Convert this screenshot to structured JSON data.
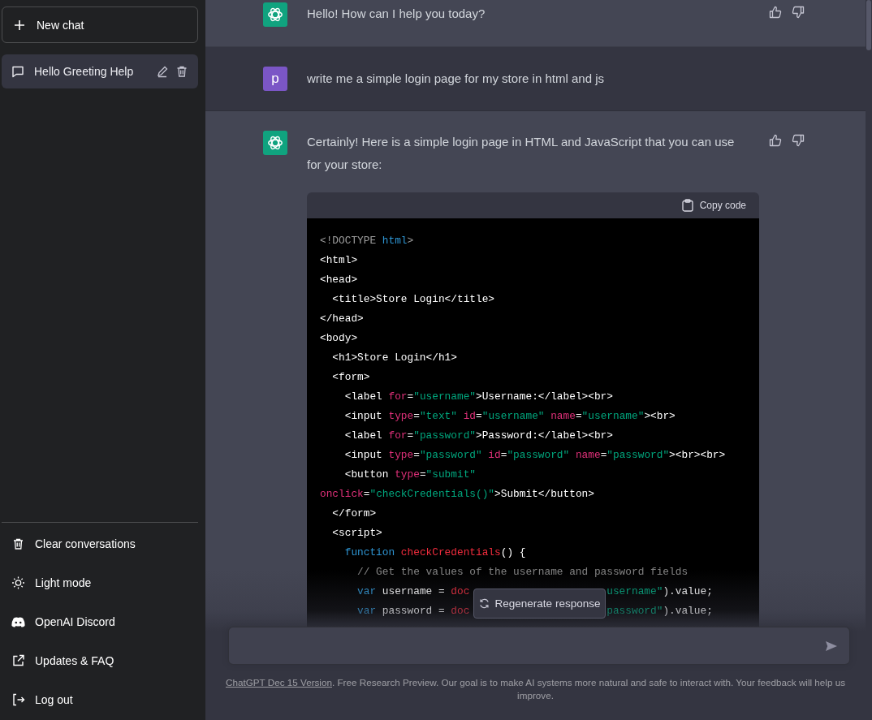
{
  "sidebar": {
    "new_chat": {
      "label": "New chat"
    },
    "conversations": [
      {
        "title": "Hello Greeting Help",
        "selected": true
      }
    ],
    "menu": [
      {
        "kind": "clear",
        "label": "Clear conversations"
      },
      {
        "kind": "theme",
        "label": "Light mode"
      },
      {
        "kind": "discord",
        "label": "OpenAI Discord"
      },
      {
        "kind": "link",
        "label": "Updates & FAQ"
      },
      {
        "kind": "logout",
        "label": "Log out"
      }
    ]
  },
  "messages": [
    {
      "kind": "assistant",
      "text": "Hello! How can I help you today?"
    },
    {
      "kind": "user",
      "avatar": "p",
      "text": "write me a simple login page for my store in html and js"
    },
    {
      "kind": "assistant",
      "text": "Certainly! Here is a simple login page in HTML and JavaScript that you can use for your store:",
      "code": {
        "copy_label": "Copy code",
        "lines": [
          {
            "tokens": [
              {
                "kind": "meta",
                "text": "<!DOCTYPE "
              },
              {
                "kind": "kw",
                "text": "html"
              },
              {
                "kind": "meta",
                "text": ">"
              }
            ]
          },
          {
            "tokens": [
              {
                "kind": "tag",
                "text": "<html>"
              }
            ]
          },
          {
            "tokens": [
              {
                "kind": "tag",
                "text": "<head>"
              }
            ]
          },
          {
            "tokens": [
              {
                "kind": "tag",
                "text": "  <title>Store Login</title>"
              }
            ]
          },
          {
            "tokens": [
              {
                "kind": "tag",
                "text": "</head>"
              }
            ]
          },
          {
            "tokens": [
              {
                "kind": "tag",
                "text": "<body>"
              }
            ]
          },
          {
            "tokens": [
              {
                "kind": "tag",
                "text": "  <h1>Store Login</h1>"
              }
            ]
          },
          {
            "tokens": [
              {
                "kind": "tag",
                "text": "  <form>"
              }
            ]
          },
          {
            "tokens": [
              {
                "kind": "tag",
                "text": "    <label "
              },
              {
                "kind": "attr",
                "text": "for"
              },
              {
                "kind": "tag",
                "text": "="
              },
              {
                "kind": "str",
                "text": "\"username\""
              },
              {
                "kind": "tag",
                "text": ">Username:</label><br>"
              }
            ]
          },
          {
            "tokens": [
              {
                "kind": "tag",
                "text": "    <input "
              },
              {
                "kind": "attr",
                "text": "type"
              },
              {
                "kind": "tag",
                "text": "="
              },
              {
                "kind": "str",
                "text": "\"text\""
              },
              {
                "kind": "attr",
                "text": " id"
              },
              {
                "kind": "tag",
                "text": "="
              },
              {
                "kind": "str",
                "text": "\"username\""
              },
              {
                "kind": "attr",
                "text": " name"
              },
              {
                "kind": "tag",
                "text": "="
              },
              {
                "kind": "str",
                "text": "\"username\""
              },
              {
                "kind": "tag",
                "text": "><br>"
              }
            ]
          },
          {
            "tokens": [
              {
                "kind": "tag",
                "text": "    <label "
              },
              {
                "kind": "attr",
                "text": "for"
              },
              {
                "kind": "tag",
                "text": "="
              },
              {
                "kind": "str",
                "text": "\"password\""
              },
              {
                "kind": "tag",
                "text": ">Password:</label><br>"
              }
            ]
          },
          {
            "tokens": [
              {
                "kind": "tag",
                "text": "    <input "
              },
              {
                "kind": "attr",
                "text": "type"
              },
              {
                "kind": "tag",
                "text": "="
              },
              {
                "kind": "str",
                "text": "\"password\""
              },
              {
                "kind": "attr",
                "text": " id"
              },
              {
                "kind": "tag",
                "text": "="
              },
              {
                "kind": "str",
                "text": "\"password\""
              },
              {
                "kind": "attr",
                "text": " name"
              },
              {
                "kind": "tag",
                "text": "="
              },
              {
                "kind": "str",
                "text": "\"password\""
              },
              {
                "kind": "tag",
                "text": "><br><br>"
              }
            ]
          },
          {
            "tokens": [
              {
                "kind": "tag",
                "text": "    <button "
              },
              {
                "kind": "attr",
                "text": "type"
              },
              {
                "kind": "tag",
                "text": "="
              },
              {
                "kind": "str",
                "text": "\"submit\""
              }
            ]
          },
          {
            "tokens": [
              {
                "kind": "attr",
                "text": "onclick"
              },
              {
                "kind": "tag",
                "text": "="
              },
              {
                "kind": "str",
                "text": "\"checkCredentials()\""
              },
              {
                "kind": "tag",
                "text": ">Submit</button>"
              }
            ]
          },
          {
            "tokens": [
              {
                "kind": "tag",
                "text": "  </form>"
              }
            ]
          },
          {
            "tokens": [
              {
                "kind": "tag",
                "text": "  <script>"
              }
            ]
          },
          {
            "tokens": [
              {
                "kind": "kw",
                "text": "    function "
              },
              {
                "kind": "fn",
                "text": "checkCredentials"
              },
              {
                "kind": "tag",
                "text": "() {"
              }
            ]
          },
          {
            "tokens": [
              {
                "kind": "cmt",
                "text": "      // Get the values of the username and password fields"
              }
            ]
          },
          {
            "tokens": [
              {
                "kind": "kw",
                "text": "      var"
              },
              {
                "kind": "tag",
                "text": " username = "
              },
              {
                "kind": "fn",
                "text": "doc"
              }
            ],
            "after": [
              {
                "kind": "str",
                "text": "username\""
              },
              {
                "kind": "tag",
                "text": ").value;"
              }
            ]
          },
          {
            "tokens": [
              {
                "kind": "kw",
                "text": "      var"
              },
              {
                "kind": "tag",
                "text": " password = "
              },
              {
                "kind": "fn",
                "text": "doc"
              }
            ],
            "after": [
              {
                "kind": "str",
                "text": "password\""
              },
              {
                "kind": "tag",
                "text": ").value;"
              }
            ]
          }
        ]
      }
    }
  ],
  "regenerate": {
    "label": "Regenerate response"
  },
  "composer": {
    "footer_link": "ChatGPT Dec 15 Version",
    "footer_text": ". Free Research Preview. Our goal is to make AI systems more natural and safe to interact with. Your feedback will help us improve."
  }
}
